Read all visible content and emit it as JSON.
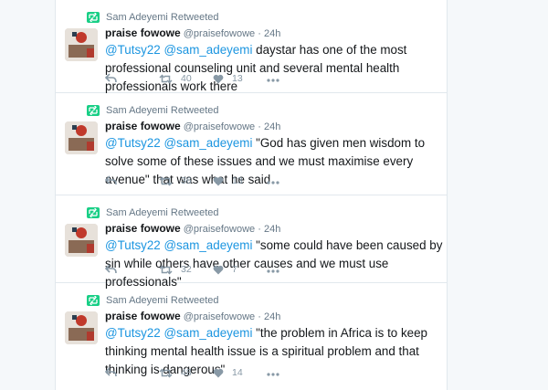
{
  "colors": {
    "accent": "#1b95e0",
    "retweet_green": "#19cf86",
    "muted": "#657786",
    "icon": "#8899a6",
    "border": "#e1e8ed"
  },
  "icons": [
    "retweet-icon",
    "reply-icon",
    "like-heart-icon",
    "more-dots-icon"
  ],
  "tweets": [
    {
      "retweeted_by": "Sam Adeyemi Retweeted",
      "name": "praise fowowe",
      "handle": "@praisefowowe",
      "separator": "·",
      "time": "24h",
      "mention1": "@Tutsy22",
      "mention2": "@sam_adeyemi",
      "body": " daystar has one of the most professional counseling unit and several mental health professionals work there",
      "retweets": "40",
      "likes": "13"
    },
    {
      "retweeted_by": "Sam Adeyemi Retweeted",
      "name": "praise fowowe",
      "handle": "@praisefowowe",
      "separator": "·",
      "time": "24h",
      "mention1": "@Tutsy22",
      "mention2": "@sam_adeyemi",
      "body": " \"God has given men wisdom to solve some of these issues and we must maximise every avenue\" that was what he said",
      "retweets": "36",
      "likes": "13"
    },
    {
      "retweeted_by": "Sam Adeyemi Retweeted",
      "name": "praise fowowe",
      "handle": "@praisefowowe",
      "separator": "·",
      "time": "24h",
      "mention1": "@Tutsy22",
      "mention2": "@sam_adeyemi",
      "body": " \"some could have been caused by sin while others have other causes and we must use professionals\"",
      "retweets": "32",
      "likes": "7"
    },
    {
      "retweeted_by": "Sam Adeyemi Retweeted",
      "name": "praise fowowe",
      "handle": "@praisefowowe",
      "separator": "·",
      "time": "24h",
      "mention1": "@Tutsy22",
      "mention2": "@sam_adeyemi",
      "body": " \"the problem in Africa is to keep thinking mental health issue is a spiritual problem and that thinking is dangerous\"",
      "retweets": "48",
      "likes": "14"
    }
  ]
}
